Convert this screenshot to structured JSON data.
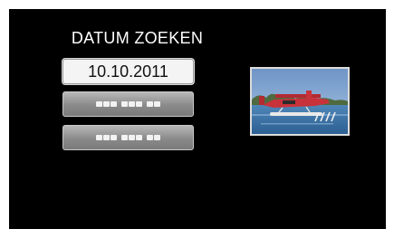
{
  "title": "DATUM ZOEKEN",
  "dates": [
    {
      "label": "10.10.2011",
      "state": "selected"
    },
    {
      "label": "",
      "state": "blank"
    },
    {
      "label": "",
      "state": "blank"
    }
  ],
  "thumbnail": {
    "icon": "seaplane-photo"
  },
  "colors": {
    "background": "#000000",
    "selected_button": "#f4f4f4",
    "blank_button": "#8a8a8a"
  }
}
